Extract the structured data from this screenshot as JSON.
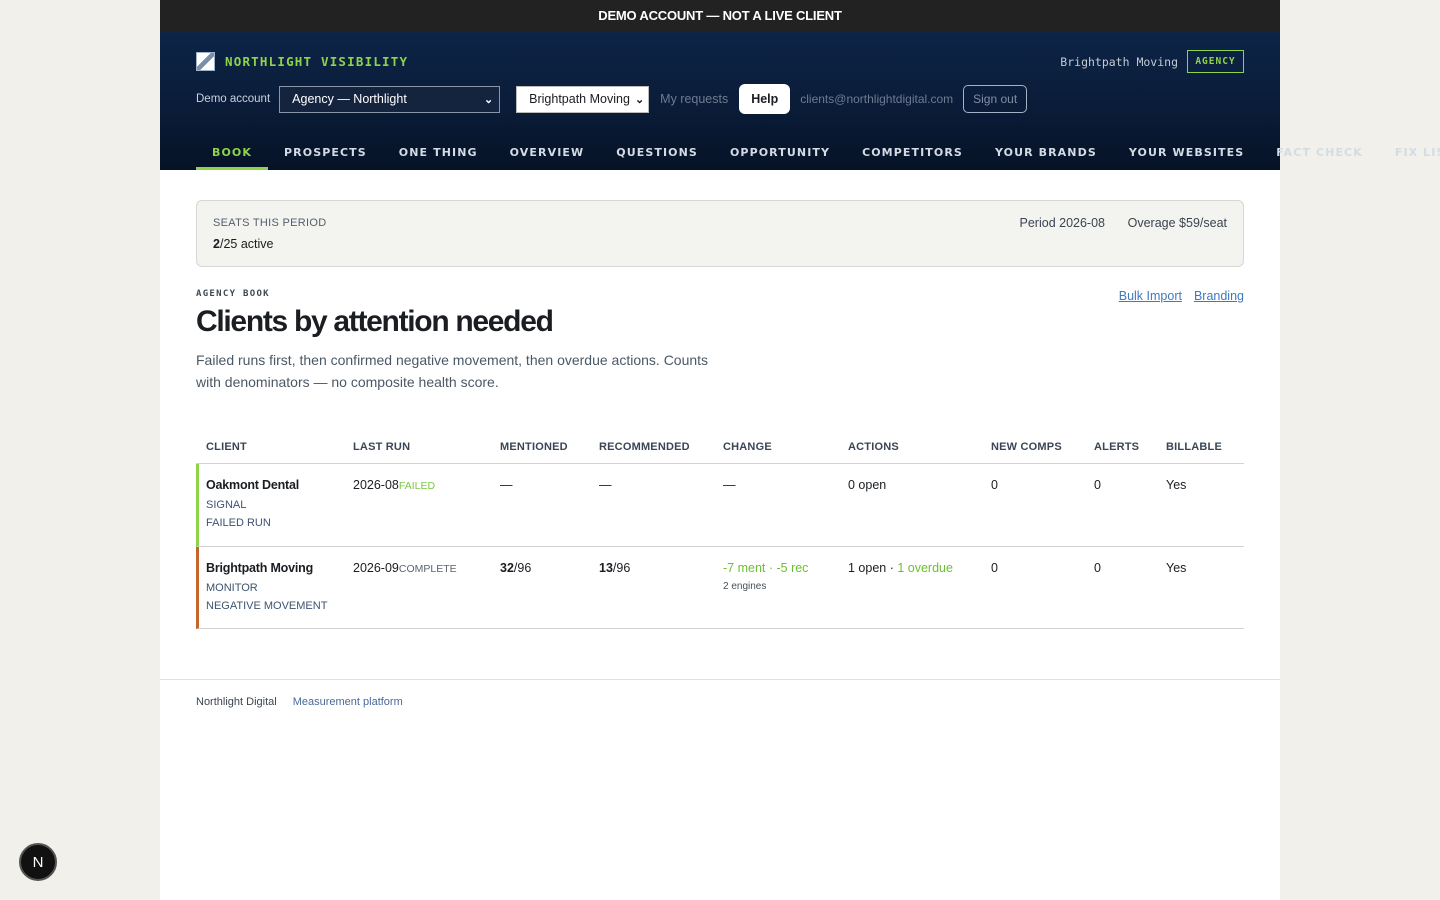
{
  "banner": {
    "text": "DEMO ACCOUNT — NOT A LIVE CLIENT"
  },
  "header": {
    "brand_name": "NORTHLIGHT VISIBILITY",
    "account_name": "Brightpath Moving",
    "account_badge": "AGENCY",
    "demo_label": "Demo account",
    "account_select": "Agency — Northlight",
    "client_select": "Brightpath Moving",
    "my_requests": "My requests",
    "help": "Help",
    "email": "clients@northlightdigital.com",
    "sign_out": "Sign out"
  },
  "tabs": [
    {
      "label": "BOOK",
      "active": true
    },
    {
      "label": "PROSPECTS"
    },
    {
      "label": "ONE THING"
    },
    {
      "label": "OVERVIEW"
    },
    {
      "label": "QUESTIONS"
    },
    {
      "label": "OPPORTUNITY"
    },
    {
      "label": "COMPETITORS"
    },
    {
      "label": "YOUR BRANDS"
    },
    {
      "label": "YOUR WEBSITES"
    },
    {
      "label": "FACT CHECK"
    },
    {
      "label": "FIX LIST"
    }
  ],
  "seats": {
    "label": "SEATS THIS PERIOD",
    "used": "2",
    "separator": "/",
    "total_text": "25 active",
    "period": "Period 2026-08",
    "overage": "Overage $59/seat"
  },
  "main": {
    "eyebrow": "AGENCY BOOK",
    "title": "Clients by attention needed",
    "subtitle": "Failed runs first, then confirmed negative movement, then overdue actions. Counts with denominators — no composite health score.",
    "bulk_import": "Bulk Import",
    "branding": "Branding"
  },
  "table": {
    "headers": [
      "CLIENT",
      "LAST RUN",
      "MENTIONED",
      "RECOMMENDED",
      "CHANGE",
      "ACTIONS",
      "NEW COMPS",
      "ALERTS",
      "BILLABLE"
    ],
    "rows": [
      {
        "client": "Oakmont Dental",
        "tier": "SIGNAL",
        "flag": "FAILED RUN",
        "last_run_date": "2026-08",
        "last_run_status": "FAILED",
        "mentioned": "—",
        "recommended": "—",
        "change": "—",
        "actions": "0 open",
        "new_comps": "0",
        "alerts": "0",
        "billable": "Yes",
        "accent": "#8dd44a"
      },
      {
        "client": "Brightpath Moving",
        "tier": "MONITOR",
        "flag": "NEGATIVE MOVEMENT",
        "last_run_date": "2026-09",
        "last_run_status": "COMPLETE",
        "mentioned_num": "32",
        "mentioned_den": "/96",
        "recommended_num": "13",
        "recommended_den": "/96",
        "change": "-7 ment · -5 rec",
        "change_sub": "2 engines",
        "actions_open": "1 open · ",
        "actions_overdue": "1 overdue",
        "new_comps": "0",
        "alerts": "0",
        "billable": "Yes",
        "accent": "#c2662b"
      }
    ]
  },
  "footer": {
    "brand": "Northlight Digital",
    "tagline": "Measurement platform"
  },
  "dev_badge": {
    "letter": "N"
  },
  "colors": {
    "accent_green": "#8dd44a",
    "header_navy": "#0d2447",
    "negative_orange": "#c2662b",
    "link_blue": "#3f7ac0"
  }
}
